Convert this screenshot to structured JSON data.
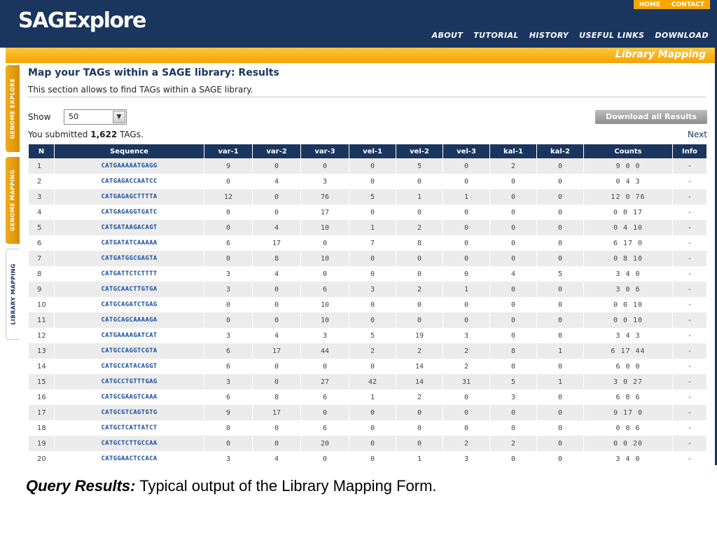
{
  "header": {
    "logo": "SAGExplore",
    "top_links": [
      "HOME",
      "CONTACT"
    ],
    "nav": [
      "ABOUT",
      "TUTORIAL",
      "HISTORY",
      "USEFUL LINKS",
      "DOWNLOAD"
    ]
  },
  "section_title": "Library Mapping",
  "side_tabs": [
    "GENOME EXPLORE",
    "GENOME MAPPING",
    "LIBRARY MAPPING"
  ],
  "page": {
    "title": "Map your TAGs within a SAGE library: Results",
    "description": "This section allows to find TAGs within a SAGE library.",
    "show_label": "Show",
    "show_value": "50",
    "download_button": "Download all Results",
    "submitted_prefix": "You submitted",
    "submitted_count": "1,622",
    "submitted_suffix": "TAGs.",
    "next_link": "Next"
  },
  "table": {
    "columns": [
      "N",
      "Sequence",
      "var-1",
      "var-2",
      "var-3",
      "vel-1",
      "vel-2",
      "vel-3",
      "kal-1",
      "kal-2",
      "Counts",
      "Info"
    ],
    "rows": [
      [
        "1",
        "CATGAAAAATGAGG",
        "9",
        "0",
        "0",
        "0",
        "5",
        "0",
        "2",
        "0",
        "9 0 0",
        "-"
      ],
      [
        "2",
        "CATGAGACCAATCC",
        "0",
        "4",
        "3",
        "0",
        "0",
        "0",
        "0",
        "0",
        "0 4 3",
        "-"
      ],
      [
        "3",
        "CATGAGAGCTTTTA",
        "12",
        "0",
        "76",
        "5",
        "1",
        "1",
        "0",
        "0",
        "12 0 76",
        "-"
      ],
      [
        "4",
        "CATGAGAGGTGATC",
        "0",
        "0",
        "17",
        "0",
        "0",
        "0",
        "0",
        "0",
        "0 0 17",
        "-"
      ],
      [
        "5",
        "CATGATAAGACAGT",
        "0",
        "4",
        "10",
        "1",
        "2",
        "0",
        "0",
        "0",
        "0 4 10",
        "-"
      ],
      [
        "6",
        "CATGATATCAAAAA",
        "6",
        "17",
        "0",
        "7",
        "8",
        "0",
        "0",
        "0",
        "6 17 0",
        "-"
      ],
      [
        "7",
        "CATGATGGCGAGTA",
        "0",
        "8",
        "10",
        "0",
        "0",
        "0",
        "0",
        "0",
        "0 8 10",
        "-"
      ],
      [
        "8",
        "CATGATTCTCTTTT",
        "3",
        "4",
        "0",
        "0",
        "0",
        "0",
        "4",
        "5",
        "3 4 0",
        "-"
      ],
      [
        "9",
        "CATGCAACTTGTGA",
        "3",
        "0",
        "6",
        "3",
        "2",
        "1",
        "0",
        "0",
        "3 0 6",
        "-"
      ],
      [
        "10",
        "CATGCAGATCTGAG",
        "0",
        "0",
        "10",
        "0",
        "0",
        "0",
        "0",
        "0",
        "0 0 10",
        "-"
      ],
      [
        "11",
        "CATGCAGCAAAAGA",
        "0",
        "0",
        "10",
        "0",
        "0",
        "0",
        "0",
        "0",
        "0 0 10",
        "-"
      ],
      [
        "12",
        "CATGAAAAGATCAT",
        "3",
        "4",
        "3",
        "5",
        "19",
        "3",
        "0",
        "0",
        "3 4 3",
        "-"
      ],
      [
        "13",
        "CATGCCAGGTCGTA",
        "6",
        "17",
        "44",
        "2",
        "2",
        "2",
        "8",
        "1",
        "6 17 44",
        "-"
      ],
      [
        "14",
        "CATGCCATACAGGT",
        "6",
        "0",
        "0",
        "0",
        "14",
        "2",
        "0",
        "0",
        "6 0 0",
        "-"
      ],
      [
        "15",
        "CATGCCTGTTTGAG",
        "3",
        "0",
        "27",
        "42",
        "14",
        "31",
        "5",
        "1",
        "3 0 27",
        "-"
      ],
      [
        "16",
        "CATGCGAAGTCAAA",
        "6",
        "8",
        "6",
        "1",
        "2",
        "0",
        "3",
        "0",
        "6 8 6",
        "-"
      ],
      [
        "17",
        "CATGCGTCAGTGTG",
        "9",
        "17",
        "0",
        "0",
        "0",
        "0",
        "0",
        "0",
        "9 17 0",
        "-"
      ],
      [
        "18",
        "CATGCTCATTATCT",
        "0",
        "0",
        "6",
        "0",
        "0",
        "0",
        "0",
        "0",
        "0 0 6",
        "-"
      ],
      [
        "19",
        "CATGCTCTTGCCAA",
        "0",
        "0",
        "20",
        "0",
        "0",
        "2",
        "2",
        "0",
        "0 0 20",
        "-"
      ],
      [
        "20",
        "CATGGAACTCCACA",
        "3",
        "4",
        "0",
        "0",
        "1",
        "3",
        "0",
        "0",
        "3 4 0",
        "-"
      ]
    ]
  },
  "caption": {
    "label": "Query Results:",
    "text": "Typical output of the Library Mapping Form."
  },
  "colors": {
    "navy": "#1a355e",
    "orange": "#f6a800",
    "row_alt": "#ececec",
    "sequence_link": "#1a4fa0"
  }
}
